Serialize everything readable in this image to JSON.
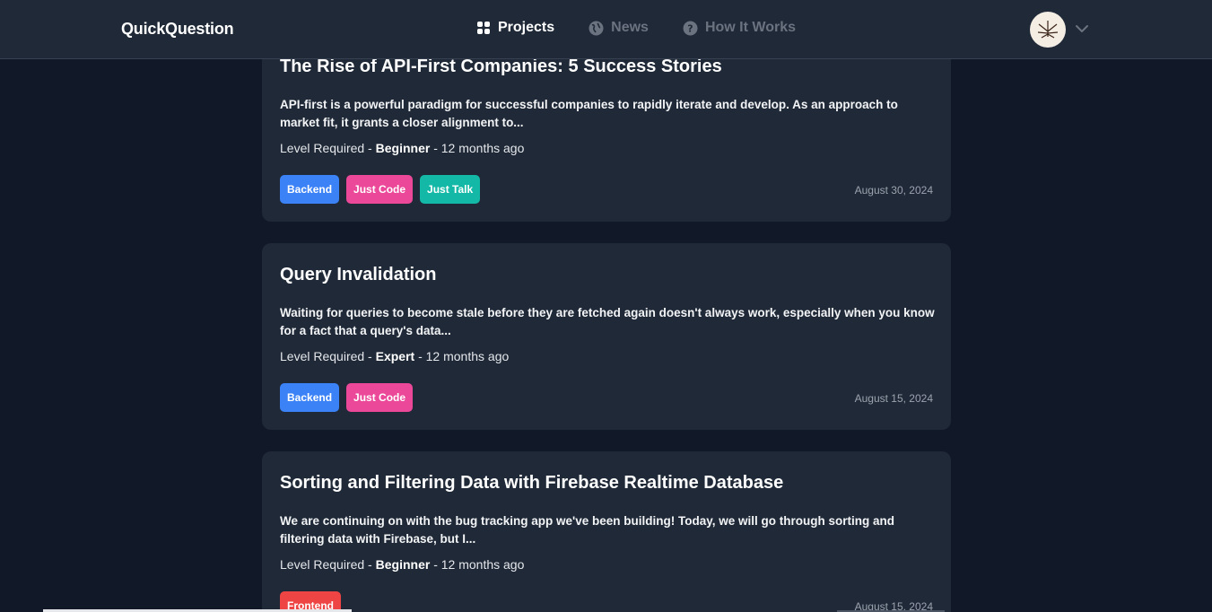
{
  "app": {
    "brand": "QuickQuestion"
  },
  "nav": {
    "items": [
      {
        "label": "Projects",
        "icon": "grid-icon",
        "active": true
      },
      {
        "label": "News",
        "icon": "globe-icon",
        "active": false
      },
      {
        "label": "How It Works",
        "icon": "question-circle-icon",
        "active": false
      }
    ]
  },
  "user": {
    "avatar_icon": "cannabis-leaf-avatar",
    "menu_icon": "chevron-down-icon"
  },
  "colors": {
    "Backend": "#3b82f6",
    "Just Code": "#ec4899",
    "Just Talk": "#14b8a6",
    "Frontend": "#ef4444"
  },
  "cards": [
    {
      "title": "The Rise of API-First Companies: 5 Success Stories",
      "description": "API-first is a powerful paradigm for successful companies to rapidly iterate and develop. As an approach to market fit, it grants a closer alignment to...",
      "level_prefix": "Level Required - ",
      "level": "Beginner",
      "age": " - 12 months ago",
      "tags": [
        "Backend",
        "Just Code",
        "Just Talk"
      ],
      "date": "August 30, 2024"
    },
    {
      "title": "Query Invalidation",
      "description": "Waiting for queries to become stale before they are fetched again doesn't always work, especially when you know for a fact that a query's data...",
      "level_prefix": "Level Required - ",
      "level": "Expert",
      "age": " - 12 months ago",
      "tags": [
        "Backend",
        "Just Code"
      ],
      "date": "August 15, 2024"
    },
    {
      "title": "Sorting and Filtering Data with Firebase Realtime Database",
      "description": "We are continuing on with the bug tracking app we've been building! Today, we will go through sorting and filtering data with Firebase, but I...",
      "level_prefix": "Level Required - ",
      "level": "Beginner",
      "age": " - 12 months ago",
      "tags": [
        "Frontend"
      ],
      "date": "August 15, 2024"
    }
  ]
}
